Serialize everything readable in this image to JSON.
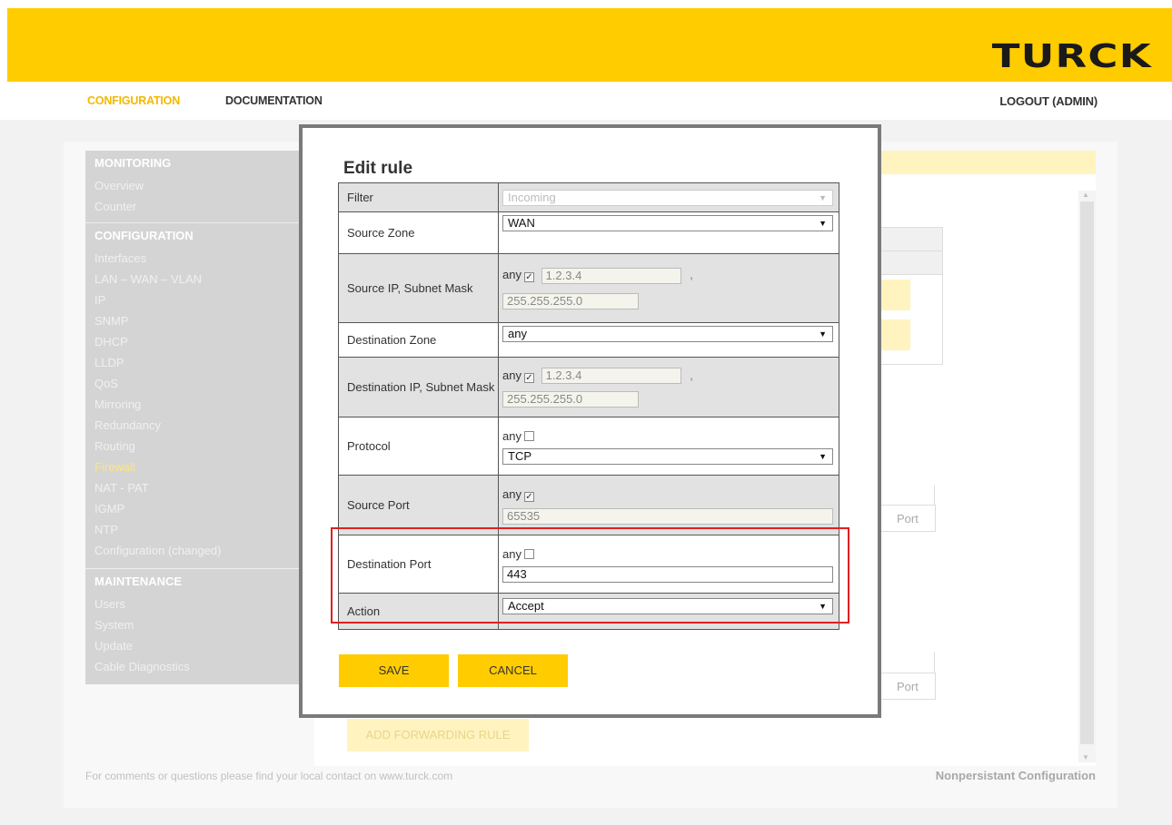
{
  "brand": {
    "logo_text": "TURCK",
    "primary_color": "#ffcc00"
  },
  "topnav": {
    "configuration": "CONFIGURATION",
    "documentation": "DOCUMENTATION",
    "logout": "LOGOUT (ADMIN)"
  },
  "sidebar": {
    "monitoring": "MONITORING",
    "overview": "Overview",
    "counter": "Counter",
    "configuration": "CONFIGURATION",
    "interfaces": "Interfaces",
    "lan_wan_vlan": "LAN – WAN – VLAN",
    "ip": "IP",
    "snmp": "SNMP",
    "dhcp": "DHCP",
    "lldp": "LLDP",
    "qos": "QoS",
    "mirroring": "Mirroring",
    "redundancy": "Redundancy",
    "routing": "Routing",
    "firewall": "Firewall",
    "nat_pat": "NAT - PAT",
    "igmp": "IGMP",
    "ntp": "NTP",
    "config_changed": "Configuration (changed)",
    "maintenance": "MAINTENANCE",
    "users": "Users",
    "system": "System",
    "update": "Update",
    "cable_diag": "Cable Diagnostics"
  },
  "background": {
    "port_1": "Port",
    "port_2": "Port",
    "add_forwarding_rule": "ADD FORWARDING RULE"
  },
  "footer": {
    "contact": "For comments or questions please find your local contact on www.turck.com",
    "status": "Nonpersistant Configuration"
  },
  "modal": {
    "title": "Edit rule",
    "filter": {
      "label": "Filter",
      "value": "Incoming"
    },
    "source_zone": {
      "label": "Source Zone",
      "value": "WAN"
    },
    "source_ip": {
      "label": "Source IP, Subnet Mask",
      "any_label": "any",
      "any_checked": true,
      "ip": "1.2.3.4",
      "separator": ",",
      "mask": "255.255.255.0"
    },
    "dest_zone": {
      "label": "Destination Zone",
      "value": "any"
    },
    "dest_ip": {
      "label": "Destination IP, Subnet Mask",
      "any_label": "any",
      "any_checked": true,
      "ip": "1.2.3.4",
      "separator": ",",
      "mask": "255.255.255.0"
    },
    "protocol": {
      "label": "Protocol",
      "any_label": "any",
      "any_checked": false,
      "value": "TCP"
    },
    "source_port": {
      "label": "Source Port",
      "any_label": "any",
      "any_checked": true,
      "value": "65535"
    },
    "dest_port": {
      "label": "Destination Port",
      "any_label": "any",
      "any_checked": false,
      "value": "443"
    },
    "action": {
      "label": "Action",
      "value": "Accept"
    },
    "save": "SAVE",
    "cancel": "CANCEL"
  },
  "icons": {
    "dropdown": "chevron-down-icon",
    "checkbox_checked": "check-icon"
  },
  "colors": {
    "highlight_border": "#e02020",
    "active_nav": "#f2b800"
  }
}
